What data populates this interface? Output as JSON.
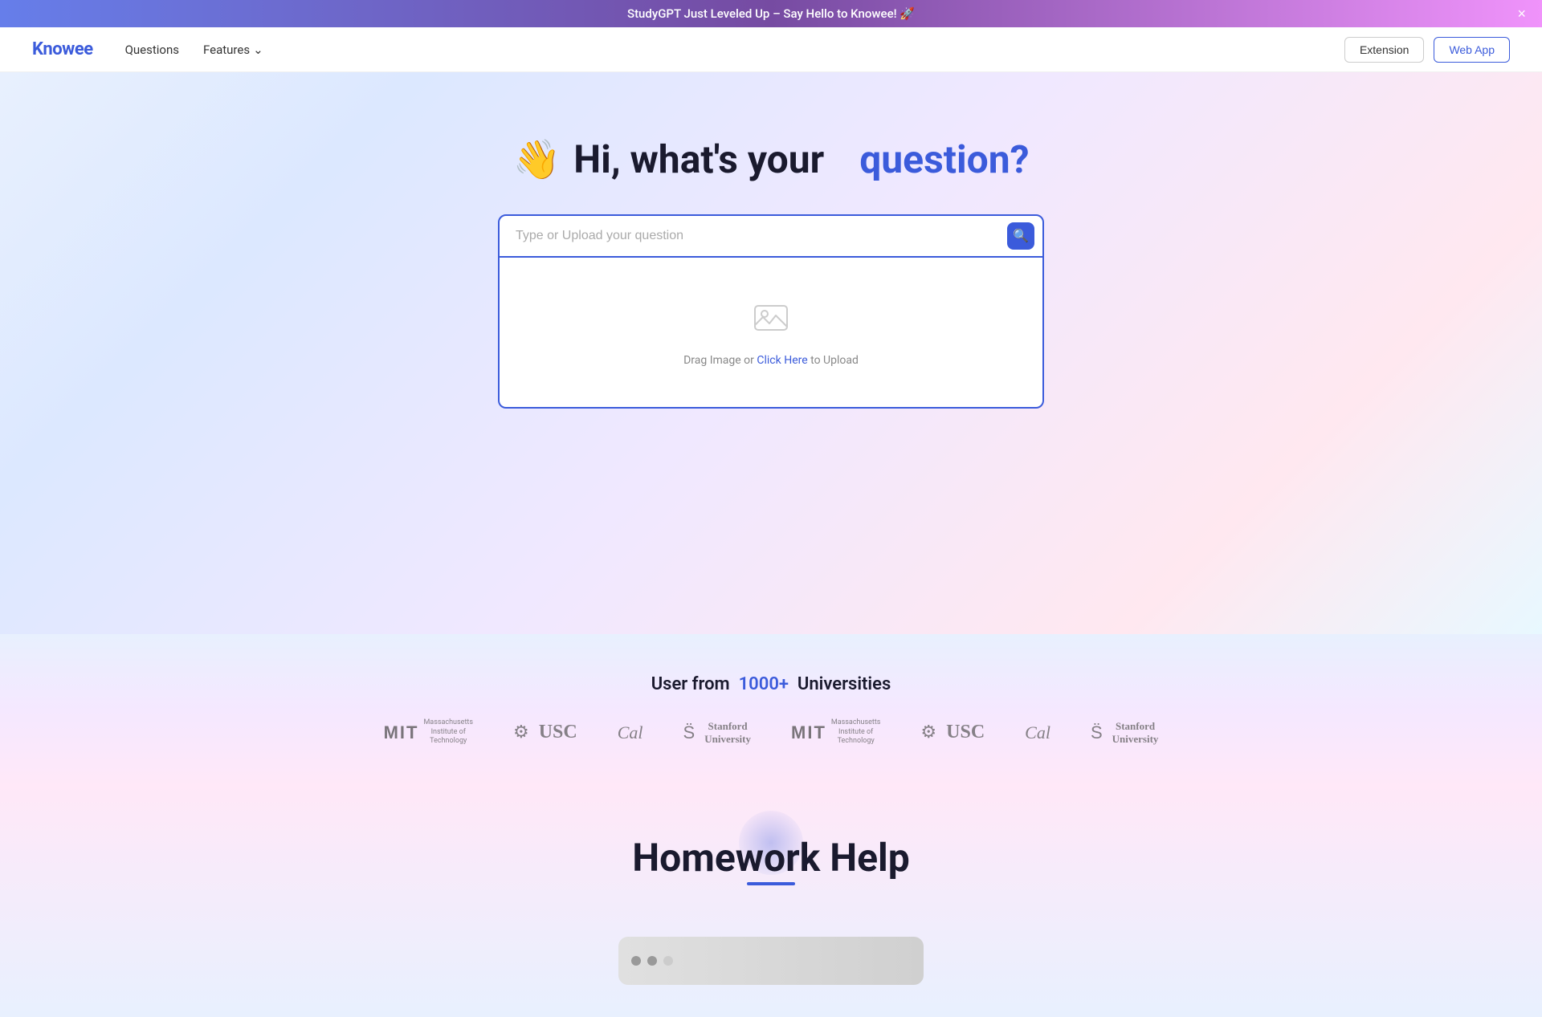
{
  "banner": {
    "text": "StudyGPT Just Leveled Up – Say Hello to Knowee! 🚀",
    "close_label": "×"
  },
  "navbar": {
    "logo": "Knowee",
    "links": [
      {
        "label": "Questions",
        "id": "questions"
      },
      {
        "label": "Features",
        "id": "features",
        "has_dropdown": true
      }
    ],
    "extension_label": "Extension",
    "webapp_label": "Web App"
  },
  "hero": {
    "wave_emoji": "👋",
    "title_prefix": "Hi, what's your",
    "title_highlight": "question?",
    "search_placeholder": "Type or Upload your question",
    "upload_text_before": "Drag Image or ",
    "upload_link": "Click Here",
    "upload_text_after": " to Upload"
  },
  "universities": {
    "title_prefix": "User from",
    "count": "1000+",
    "title_suffix": "Universities",
    "logos": [
      {
        "id": "mit1",
        "abbrev": "MIT",
        "name": "Massachusetts\nInstitute of\nTechnology"
      },
      {
        "id": "usc1",
        "abbrev": "USC",
        "symbol": "⚙"
      },
      {
        "id": "cal1",
        "abbrev": "Cal"
      },
      {
        "id": "stanford1",
        "abbrev": "S",
        "name": "Stanford\nUniversity"
      },
      {
        "id": "mit2",
        "abbrev": "MIT",
        "name": "Massachusetts\nInstitute of\nTechnology"
      },
      {
        "id": "usc2",
        "abbrev": "USC",
        "symbol": "⚙"
      },
      {
        "id": "cal2",
        "abbrev": "Cal"
      },
      {
        "id": "stanford2",
        "abbrev": "S",
        "name": "Stanford\nUniversity"
      }
    ]
  },
  "homework": {
    "title": "Homework Help"
  }
}
